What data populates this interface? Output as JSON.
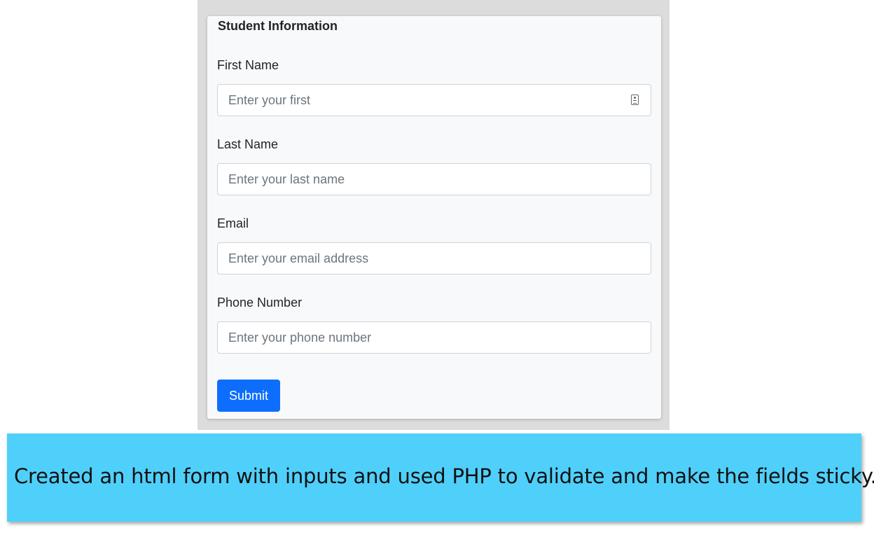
{
  "form": {
    "title": "Student Information",
    "fields": [
      {
        "label": "First Name",
        "placeholder": "Enter your first",
        "value": ""
      },
      {
        "label": "Last Name",
        "placeholder": "Enter your last name",
        "value": ""
      },
      {
        "label": "Email",
        "placeholder": "Enter your email address",
        "value": ""
      },
      {
        "label": "Phone Number",
        "placeholder": "Enter your phone number",
        "value": ""
      }
    ],
    "submit_label": "Submit",
    "first_field_icon": "contact-card-icon"
  },
  "caption": {
    "text": "Created an html form with inputs and used PHP to validate and make the fields sticky."
  },
  "colors": {
    "button_primary": "#0d6efd",
    "caption_background": "#4fd0fb",
    "card_background": "#f8f9fa",
    "frame_background": "#dcdcdc"
  }
}
